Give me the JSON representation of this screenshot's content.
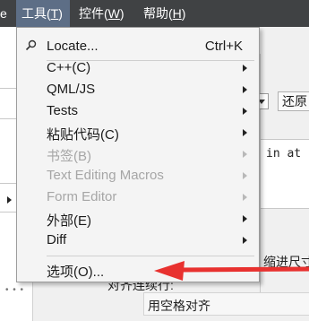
{
  "menubar": {
    "edge_label": "e",
    "tools_label": "工具(T)",
    "controls_label": "控件(W)",
    "help_label": "帮助(H)"
  },
  "menu": {
    "locate": {
      "label": "Locate...",
      "shortcut": "Ctrl+K",
      "icon": "magnifier-icon"
    },
    "items": [
      {
        "label": "C++(C)",
        "enabled": true,
        "submenu": true
      },
      {
        "label": "QML/JS",
        "enabled": true,
        "submenu": true
      },
      {
        "label": "Tests",
        "enabled": true,
        "submenu": true
      },
      {
        "label": "粘贴代码(C)",
        "enabled": true,
        "submenu": true
      },
      {
        "label": "书签(B)",
        "enabled": false,
        "submenu": true
      },
      {
        "label": "Text Editing Macros",
        "enabled": false,
        "submenu": true
      },
      {
        "label": "Form Editor",
        "enabled": false,
        "submenu": true
      },
      {
        "label": "外部(E)",
        "enabled": true,
        "submenu": true
      },
      {
        "label": "Diff",
        "enabled": true,
        "submenu": true
      }
    ],
    "options_label": "选项(O)..."
  },
  "background": {
    "restore_button": "还原",
    "code_snippet": "in at co",
    "indent_label": "缩进尺寸",
    "alignment_label": "对齐连续行:",
    "alignment_value": "用空格对齐"
  },
  "colors": {
    "menubar_bg": "#404244",
    "menubar_active": "#5d6e86",
    "annotation_arrow": "#e8312f"
  }
}
